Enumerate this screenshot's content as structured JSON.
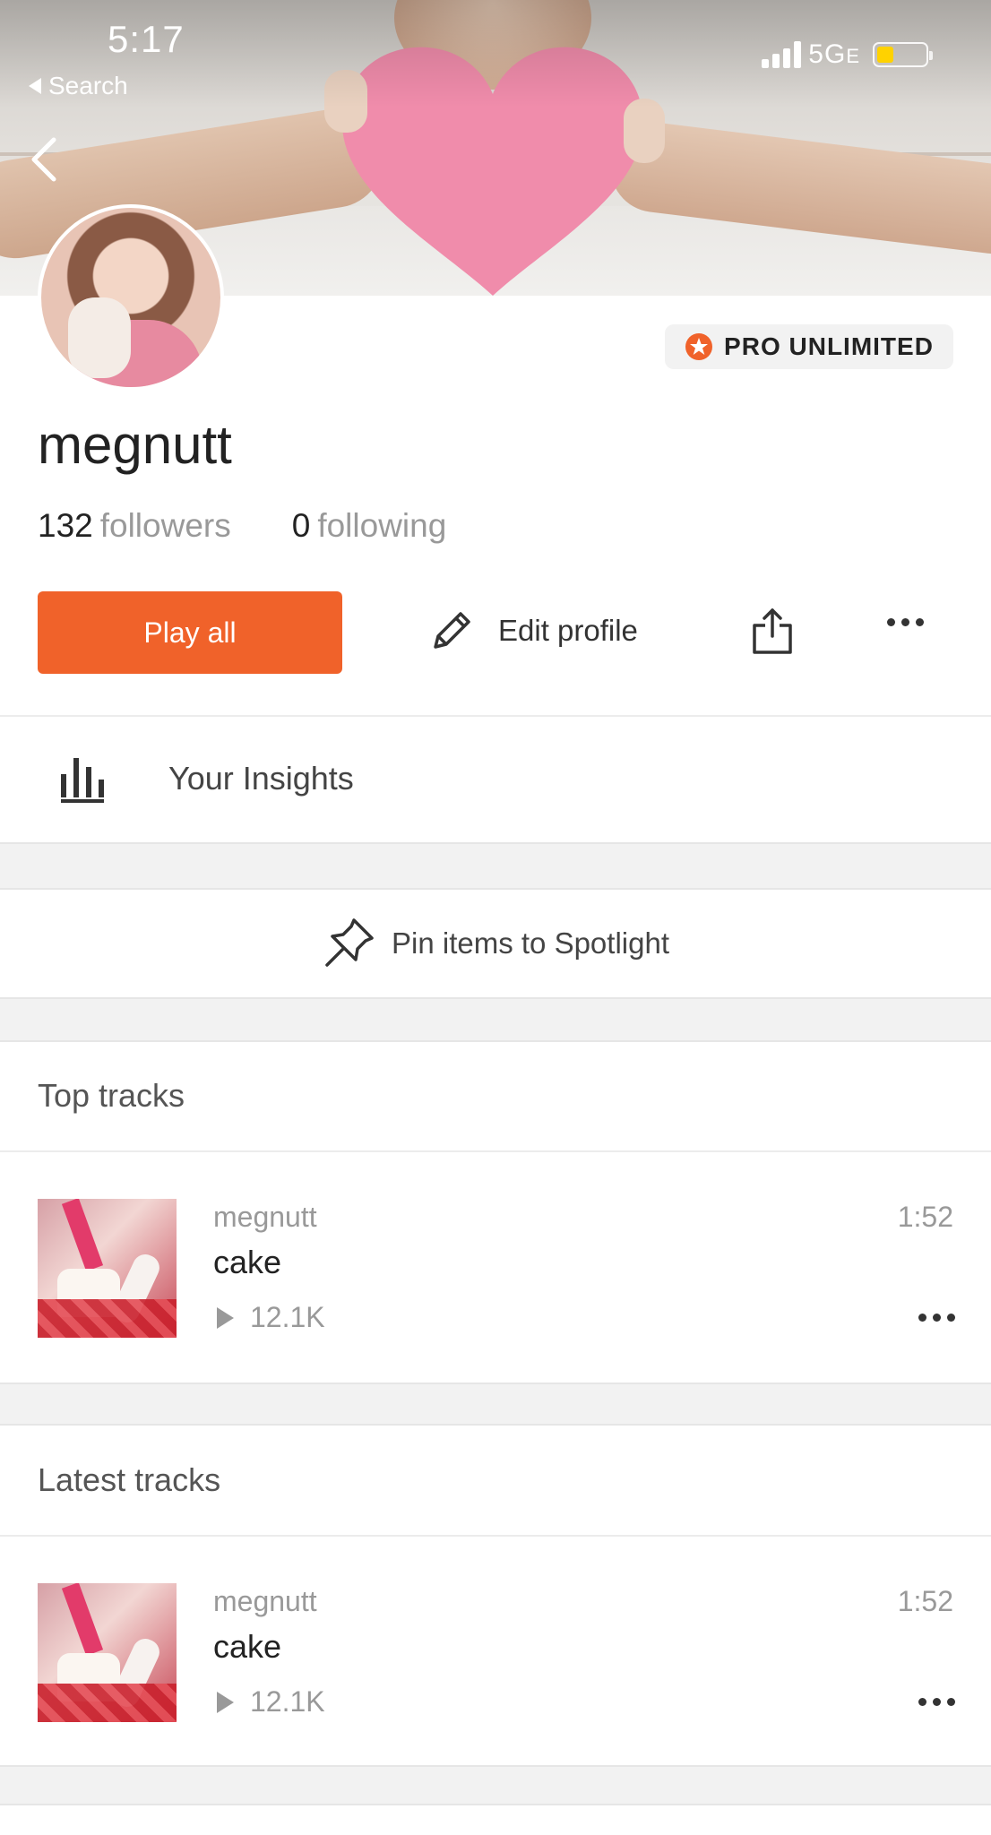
{
  "status_bar": {
    "time": "5:17",
    "back_app": "Search",
    "network": "5G",
    "network_suffix": "E"
  },
  "profile": {
    "username": "megnutt",
    "badge": "PRO UNLIMITED",
    "followers_count": "132",
    "followers_label": "followers",
    "following_count": "0",
    "following_label": "following"
  },
  "actions": {
    "play_all": "Play all",
    "edit_profile": "Edit profile"
  },
  "insights_label": "Your Insights",
  "spotlight_label": "Pin items to Spotlight",
  "sections": {
    "top_tracks": {
      "title": "Top tracks",
      "tracks": [
        {
          "artist": "megnutt",
          "title": "cake",
          "plays": "12.1K",
          "duration": "1:52"
        }
      ]
    },
    "latest_tracks": {
      "title": "Latest tracks",
      "tracks": [
        {
          "artist": "megnutt",
          "title": "cake",
          "plays": "12.1K",
          "duration": "1:52"
        }
      ]
    }
  },
  "colors": {
    "accent": "#f0622a",
    "text_primary": "#222222",
    "text_secondary": "#999999"
  }
}
